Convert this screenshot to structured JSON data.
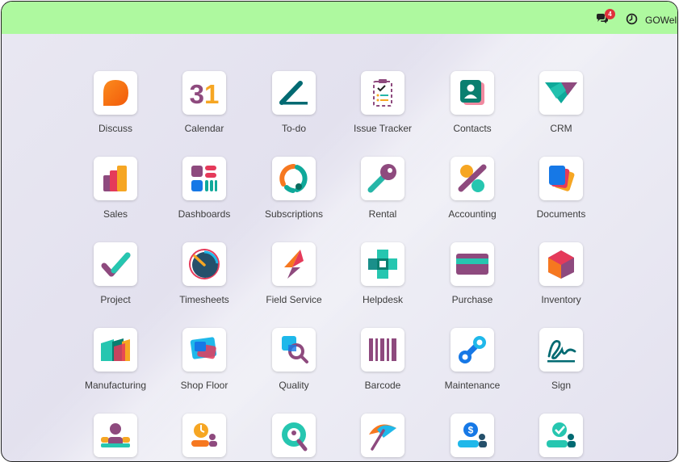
{
  "topbar": {
    "color": "#aef99f",
    "chat_icon": "chat-bubbles-icon",
    "chat_badge": "4",
    "clock_icon": "clock-icon",
    "user": "GOWell"
  },
  "apps": [
    {
      "label": "Discuss",
      "icon": "discuss-icon"
    },
    {
      "label": "Calendar",
      "icon": "calendar-icon"
    },
    {
      "label": "To-do",
      "icon": "todo-icon"
    },
    {
      "label": "Issue Tracker",
      "icon": "issue-tracker-icon"
    },
    {
      "label": "Contacts",
      "icon": "contacts-icon"
    },
    {
      "label": "CRM",
      "icon": "crm-icon"
    },
    {
      "label": "Sales",
      "icon": "sales-icon"
    },
    {
      "label": "Dashboards",
      "icon": "dashboards-icon"
    },
    {
      "label": "Subscriptions",
      "icon": "subscriptions-icon"
    },
    {
      "label": "Rental",
      "icon": "rental-icon"
    },
    {
      "label": "Accounting",
      "icon": "accounting-icon"
    },
    {
      "label": "Documents",
      "icon": "documents-icon"
    },
    {
      "label": "Project",
      "icon": "project-icon"
    },
    {
      "label": "Timesheets",
      "icon": "timesheets-icon"
    },
    {
      "label": "Field Service",
      "icon": "field-service-icon"
    },
    {
      "label": "Helpdesk",
      "icon": "helpdesk-icon"
    },
    {
      "label": "Purchase",
      "icon": "purchase-icon"
    },
    {
      "label": "Inventory",
      "icon": "inventory-icon"
    },
    {
      "label": "Manufacturing",
      "icon": "manufacturing-icon"
    },
    {
      "label": "Shop Floor",
      "icon": "shop-floor-icon"
    },
    {
      "label": "Quality",
      "icon": "quality-icon"
    },
    {
      "label": "Barcode",
      "icon": "barcode-icon"
    },
    {
      "label": "Maintenance",
      "icon": "maintenance-icon"
    },
    {
      "label": "Sign",
      "icon": "sign-icon"
    },
    {
      "label": "",
      "icon": "employees-icon"
    },
    {
      "label": "",
      "icon": "appraisals-icon"
    },
    {
      "label": "",
      "icon": "recruitment-icon"
    },
    {
      "label": "",
      "icon": "time-off-icon"
    },
    {
      "label": "",
      "icon": "expenses-icon"
    },
    {
      "label": "",
      "icon": "approvals-icon"
    }
  ],
  "calendar_day": "31"
}
